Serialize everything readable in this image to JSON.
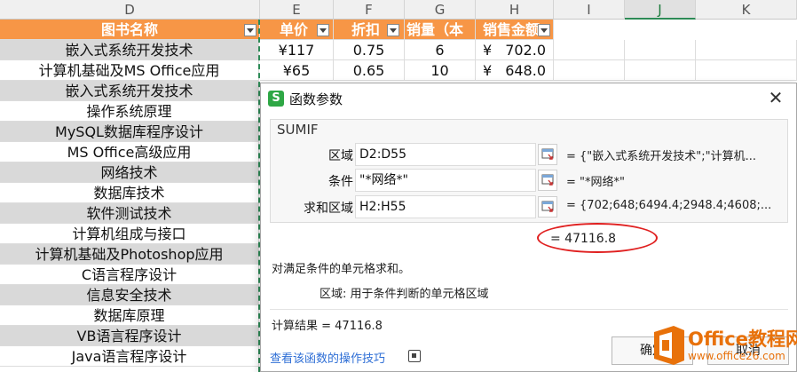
{
  "sheet": {
    "col_headers": [
      "D",
      "E",
      "F",
      "G",
      "H",
      "I",
      "J",
      "K"
    ],
    "active_col": "J",
    "table_headers": [
      "图书名称",
      "单价",
      "折扣",
      "销量（本",
      "销售金额"
    ],
    "rows": [
      {
        "name": "嵌入式系统开发技术",
        "price": "¥117",
        "discount": "0.75",
        "qty": "6",
        "currency": "¥",
        "amount": "702.0"
      },
      {
        "name": "计算机基础及MS Office应用",
        "price": "¥65",
        "discount": "0.65",
        "qty": "10",
        "currency": "¥",
        "amount": "648.0"
      },
      {
        "name": "嵌入式系统开发技术"
      },
      {
        "name": "操作系统原理"
      },
      {
        "name": "MySQL数据库程序设计"
      },
      {
        "name": "MS Office高级应用"
      },
      {
        "name": "网络技术"
      },
      {
        "name": "数据库技术"
      },
      {
        "name": "软件测试技术"
      },
      {
        "name": "计算机组成与接口"
      },
      {
        "name": "计算机基础及Photoshop应用"
      },
      {
        "name": "C语言程序设计"
      },
      {
        "name": "信息安全技术"
      },
      {
        "name": "数据库原理"
      },
      {
        "name": "VB语言程序设计"
      },
      {
        "name": "Java语言程序设计"
      }
    ]
  },
  "dialog": {
    "icon_letter": "S",
    "title": "函数参数",
    "function_name": "SUMIF",
    "args": [
      {
        "label": "区域",
        "input": "D2:D55",
        "value": "= {\"嵌入式系统开发技术\";\"计算机..."
      },
      {
        "label": "条件",
        "input": "\"*网络*\"",
        "value": "= \"*网络*\""
      },
      {
        "label": "求和区域",
        "input": "H2:H55",
        "value": "= {702;648;6494.4;2948.4;4608;..."
      }
    ],
    "preview_result": "= 47116.8",
    "description": "对满足条件的单元格求和。",
    "arg_description": "区域:  用于条件判断的单元格区域",
    "result_line": "计算结果 =  47116.8",
    "help_link": "查看该函数的操作技巧",
    "ok_label": "确定",
    "cancel_label": "取消"
  },
  "watermark": {
    "brand": "Office教程网",
    "url": "www.office26.com"
  }
}
